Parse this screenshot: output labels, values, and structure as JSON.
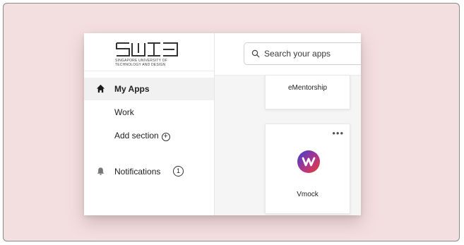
{
  "brand": {
    "logo_line1": "SINGAPORE UNIVERSITY OF",
    "logo_line2": "TECHNOLOGY AND DESIGN"
  },
  "sidebar": {
    "items": [
      {
        "label": "My Apps",
        "icon": "home-icon",
        "active": true
      },
      {
        "label": "Work"
      },
      {
        "label": "Add section",
        "icon": "add-circle-icon"
      },
      {
        "label": "Notifications",
        "icon": "bell-icon",
        "badge": "1"
      }
    ]
  },
  "search": {
    "placeholder": "Search your apps"
  },
  "apps": [
    {
      "label": "eMentorship"
    },
    {
      "label": "Vmock",
      "icon": "vmock-logo",
      "menu_icon": "more-icon"
    }
  ],
  "colors": {
    "background": "#f4dfe0",
    "vmock_gradient_start": "#3a3fd1",
    "vmock_gradient_end": "#e8412e"
  }
}
